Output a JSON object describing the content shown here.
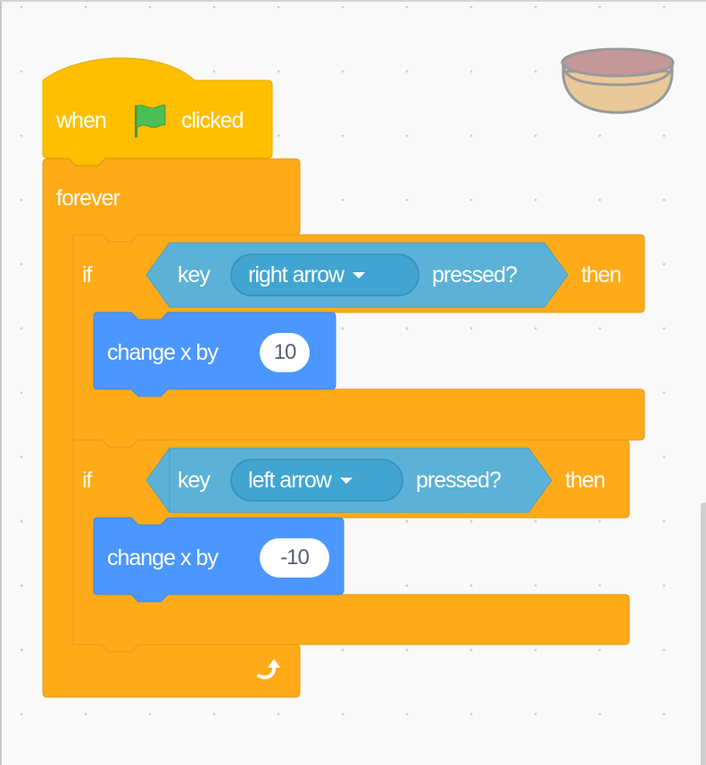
{
  "workspace": {
    "label": "Scratch code area",
    "colors": {
      "background": "#f9f9f9",
      "events": "#ffbf00",
      "control": "#ffab19",
      "sensing": "#5cb1d6",
      "sensing_menu": "#42a5d1",
      "motion": "#4c97ff",
      "flag": "#4cbf56"
    }
  },
  "sprite": {
    "name": "bowl-sprite-thumbnail"
  },
  "script": {
    "hat": {
      "prefix": "when",
      "icon": "green-flag-icon",
      "suffix": "clicked"
    },
    "forever": {
      "label": "forever",
      "loop_icon": "loop-arrow-icon"
    },
    "conditions": [
      {
        "if_label": "if",
        "sensing": {
          "prefix": "key",
          "key": "right arrow",
          "suffix": "pressed?"
        },
        "then_label": "then",
        "action": {
          "label": "change x by",
          "value": "10"
        }
      },
      {
        "if_label": "if",
        "sensing": {
          "prefix": "key",
          "key": "left arrow",
          "suffix": "pressed?"
        },
        "then_label": "then",
        "action": {
          "label": "change x by",
          "value": "-10"
        }
      }
    ]
  }
}
